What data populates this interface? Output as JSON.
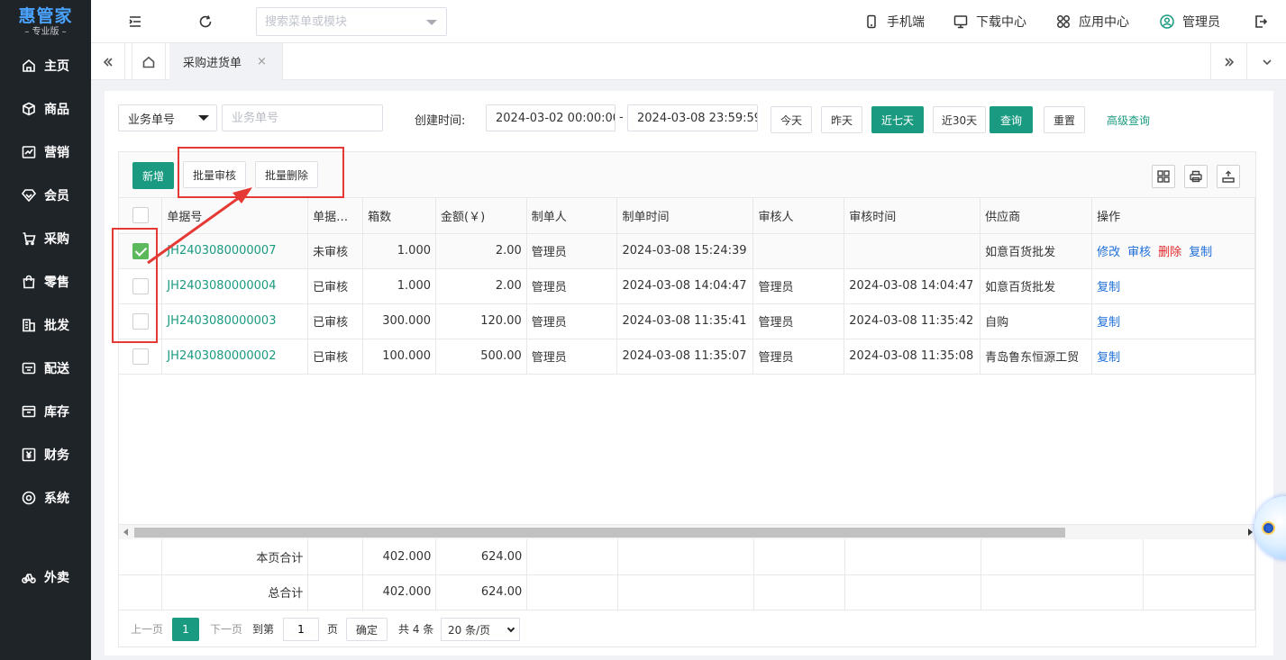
{
  "logo": {
    "title": "惠管家",
    "subtitle": "– 专业版 –"
  },
  "sidebar": {
    "items": [
      {
        "label": "主页",
        "icon": "home-icon"
      },
      {
        "label": "商品",
        "icon": "box-icon"
      },
      {
        "label": "营销",
        "icon": "chart-icon"
      },
      {
        "label": "会员",
        "icon": "diamond-icon"
      },
      {
        "label": "采购",
        "icon": "cart-icon"
      },
      {
        "label": "零售",
        "icon": "bag-icon"
      },
      {
        "label": "批发",
        "icon": "building-icon"
      },
      {
        "label": "配送",
        "icon": "truck-icon"
      },
      {
        "label": "库存",
        "icon": "inbox-icon"
      },
      {
        "label": "财务",
        "icon": "yen-icon"
      },
      {
        "label": "系统",
        "icon": "settings-icon"
      },
      {
        "label": "外卖",
        "icon": "bike-icon"
      }
    ]
  },
  "header": {
    "search_placeholder": "搜索菜单或模块",
    "links": {
      "mobile": "手机端",
      "download": "下载中心",
      "apps": "应用中心",
      "user": "管理员"
    }
  },
  "tabs": {
    "active": "采购进货单",
    "close": "×"
  },
  "filters": {
    "field_select": "业务单号",
    "field_placeholder": "业务单号",
    "created_label": "创建时间:",
    "date_start": "2024-03-02 00:00:00",
    "date_sep": "-",
    "date_end": "2024-03-08 23:59:59",
    "today": "今天",
    "yesterday": "昨天",
    "last7": "近七天",
    "last30": "近30天",
    "query": "查询",
    "reset": "重置",
    "advanced": "高级查询"
  },
  "toolbar": {
    "add": "新增",
    "batch_audit": "批量审核",
    "batch_delete": "批量删除"
  },
  "table": {
    "headers": [
      "单据号",
      "单据…",
      "箱数",
      "金额(￥)",
      "制单人",
      "制单时间",
      "审核人",
      "审核时间",
      "供应商",
      "操作"
    ],
    "rows": [
      {
        "checked": true,
        "no": "JH2403080000007",
        "status": "未审核",
        "boxes": "1.000",
        "amount": "2.00",
        "creator": "管理员",
        "created": "2024-03-08 15:24:39",
        "auditor": "",
        "audited": "",
        "supplier": "如意百货批发",
        "ops": [
          "修改",
          "审核",
          "删除",
          "复制"
        ]
      },
      {
        "checked": false,
        "no": "JH2403080000004",
        "status": "已审核",
        "boxes": "1.000",
        "amount": "2.00",
        "creator": "管理员",
        "created": "2024-03-08 14:04:47",
        "auditor": "管理员",
        "audited": "2024-03-08 14:04:47",
        "supplier": "如意百货批发",
        "ops": [
          "复制"
        ]
      },
      {
        "checked": false,
        "no": "JH2403080000003",
        "status": "已审核",
        "boxes": "300.000",
        "amount": "120.00",
        "creator": "管理员",
        "created": "2024-03-08 11:35:41",
        "auditor": "管理员",
        "audited": "2024-03-08 11:35:42",
        "supplier": "自购",
        "ops": [
          "复制"
        ]
      },
      {
        "checked": false,
        "no": "JH2403080000002",
        "status": "已审核",
        "boxes": "100.000",
        "amount": "500.00",
        "creator": "管理员",
        "created": "2024-03-08 11:35:07",
        "auditor": "管理员",
        "audited": "2024-03-08 11:35:08",
        "supplier": "青岛鲁东恒源工贸",
        "ops": [
          "复制"
        ]
      }
    ]
  },
  "totals": {
    "page_label": "本页合计",
    "page_boxes": "402.000",
    "page_amount": "624.00",
    "all_label": "总合计",
    "all_boxes": "402.000",
    "all_amount": "624.00"
  },
  "pager": {
    "prev": "上一页",
    "current": "1",
    "next": "下一页",
    "goto": "到第",
    "goto_value": "1",
    "page_unit": "页",
    "confirm": "确定",
    "total": "共 4 条",
    "page_size": "20 条/页"
  },
  "colors": {
    "accent": "#1a9a80",
    "sidebar": "#1f2429",
    "link": "#1e6fd9",
    "danger": "#e0272b",
    "annotation": "#e53935"
  }
}
